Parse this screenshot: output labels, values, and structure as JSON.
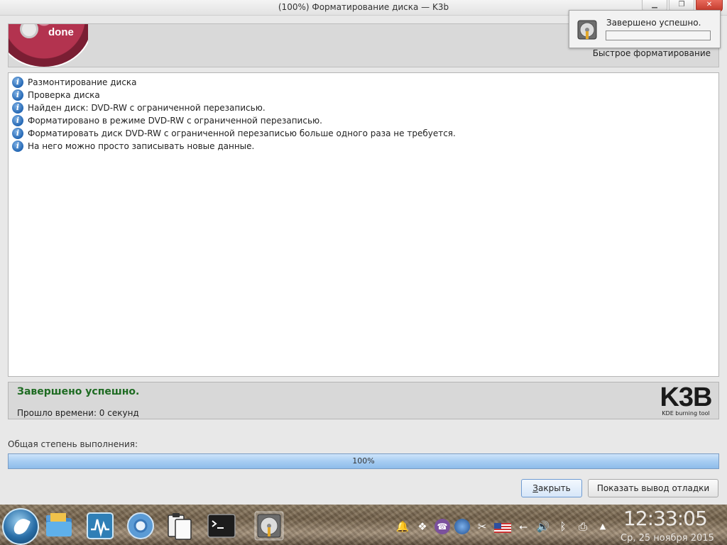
{
  "window": {
    "title": "(100%) Форматирование диска — K3b",
    "buttons": {
      "minimize": "▁",
      "maximize": "❐",
      "close": "✕"
    }
  },
  "header": {
    "logo_text": "done"
  },
  "notification": {
    "text": "Завершено успешно.",
    "operation": "Быстрое форматирование"
  },
  "log": {
    "items": [
      "Размонтирование диска",
      "Проверка диска",
      "Найден диск: DVD-RW с ограниченной перезаписью.",
      "Форматировано в режиме DVD-RW с ограниченной перезаписью.",
      "Форматировать диск DVD-RW с ограниченной перезаписью больше одного раза не требуется.",
      "На него можно просто записывать новые данные."
    ],
    "icon": "info-icon"
  },
  "status": {
    "title": "Завершено успешно.",
    "elapsed": "Прошло времени: 0 секунд",
    "logo_big": "K3B",
    "logo_small": "KDE burning tool"
  },
  "progress": {
    "label": "Общая степень выполнения:",
    "percent_text": "100%",
    "value": 1.0
  },
  "buttons": {
    "close": {
      "mnemonic": "З",
      "rest": "акрыть"
    },
    "debug": "Показать вывод отладки"
  },
  "taskbar": {
    "clock": "12:33:05",
    "date": "Ср, 25 ноября 2015",
    "tray_icons": [
      "bell-icon",
      "dropbox-icon",
      "viber-icon",
      "network-globe-icon",
      "scissors-icon",
      "us-flag-icon",
      "usb-icon",
      "volume-icon",
      "bluetooth-icon",
      "printer-icon",
      "tray-expand-icon"
    ]
  },
  "colors": {
    "success_green": "#1e6b22",
    "progress_fill": "#a7cdf2",
    "info_blue": "#2366b3"
  }
}
